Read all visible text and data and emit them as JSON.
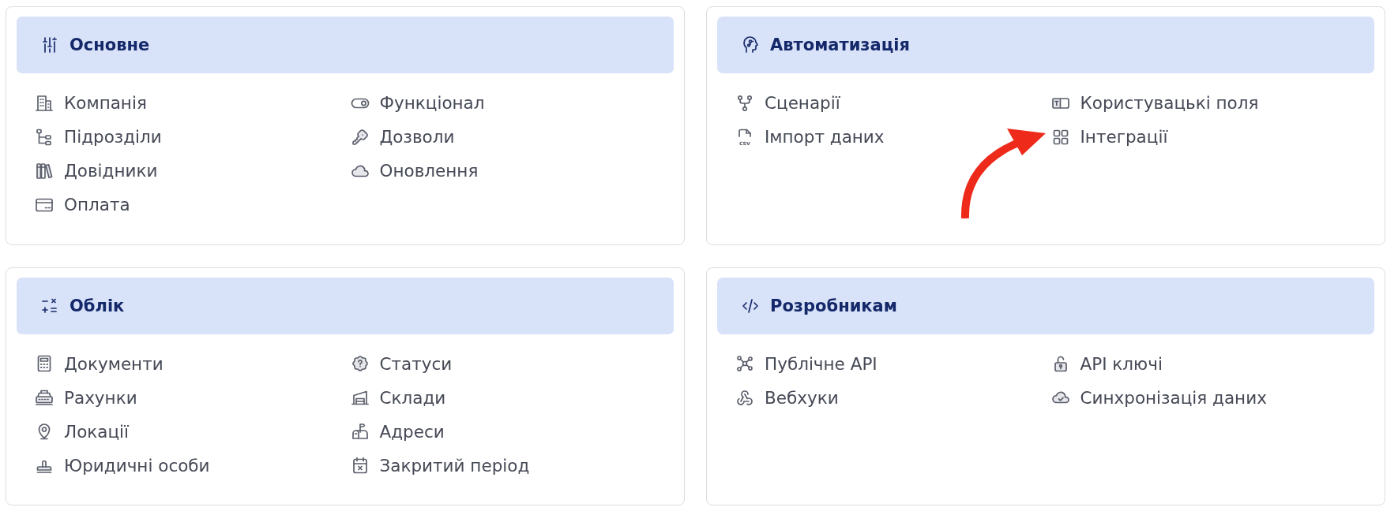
{
  "sections": [
    {
      "title": "Основне",
      "items": [
        {
          "label": "Компанія",
          "annotated": false
        },
        {
          "label": "Функціонал",
          "annotated": false
        },
        {
          "label": "Підрозділи",
          "annotated": false
        },
        {
          "label": "Дозволи",
          "annotated": false
        },
        {
          "label": "Довідники",
          "annotated": false
        },
        {
          "label": "Оновлення",
          "annotated": false
        },
        {
          "label": "Оплата",
          "annotated": false
        }
      ]
    },
    {
      "title": "Автоматизація",
      "items": [
        {
          "label": "Сценарії",
          "annotated": false
        },
        {
          "label": "Користувацькі поля",
          "annotated": false
        },
        {
          "label": "Імпорт даних",
          "icon": {
            "text": "csv"
          },
          "annotated": false
        },
        {
          "label": "Інтеграції",
          "annotated": true
        }
      ]
    },
    {
      "title": "Облік",
      "items": [
        {
          "label": "Документи",
          "annotated": false
        },
        {
          "label": "Статуси",
          "annotated": false
        },
        {
          "label": "Рахунки",
          "annotated": false
        },
        {
          "label": "Склади",
          "annotated": false
        },
        {
          "label": "Локації",
          "annotated": false
        },
        {
          "label": "Адреси",
          "annotated": false
        },
        {
          "label": "Юридичні особи",
          "annotated": false
        },
        {
          "label": "Закритий період",
          "annotated": false
        }
      ]
    },
    {
      "title": "Розробникам",
      "items": [
        {
          "label": "Публічне API",
          "annotated": false
        },
        {
          "label": "API ключі",
          "annotated": false
        },
        {
          "label": "Вебхуки",
          "annotated": false
        },
        {
          "label": "Синхронізація даних",
          "annotated": false
        }
      ]
    }
  ]
}
